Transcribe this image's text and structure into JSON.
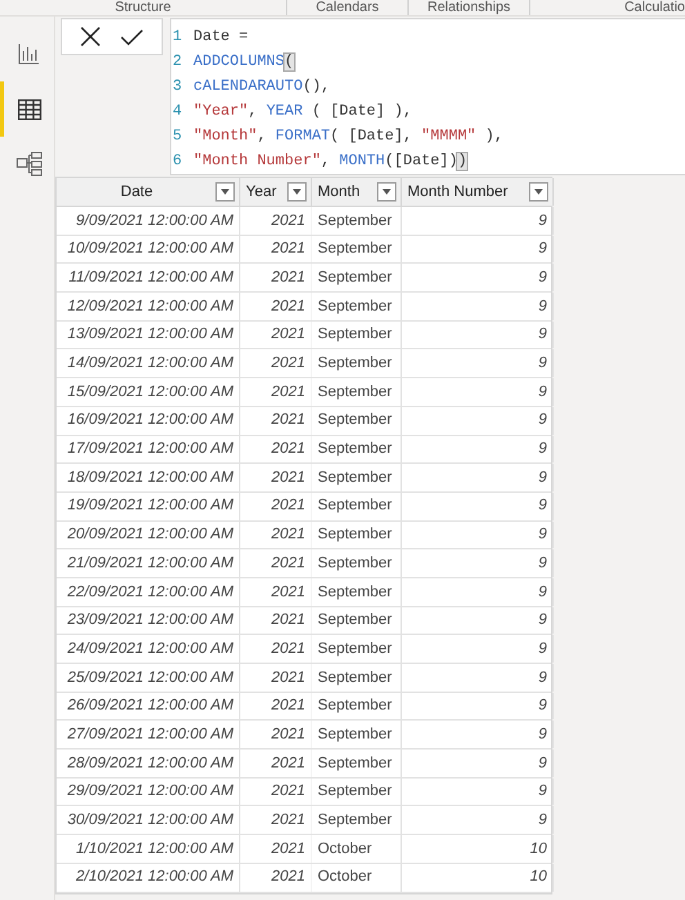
{
  "ribbon": {
    "groups": [
      "Structure",
      "Calendars",
      "Relationships",
      "Calculatio"
    ]
  },
  "sidebar": {
    "items": [
      {
        "kind": "report",
        "selected": false
      },
      {
        "kind": "data",
        "selected": true
      },
      {
        "kind": "model",
        "selected": false
      }
    ]
  },
  "formula_bar": {
    "lines": [
      [
        {
          "text": "Date =",
          "kind": "plain"
        }
      ],
      [
        {
          "text": "ADDCOLUMNS",
          "kind": "func"
        },
        {
          "text": "(",
          "kind": "match"
        }
      ],
      [
        {
          "text": "cALENDARAUTO",
          "kind": "func"
        },
        {
          "text": "(),",
          "kind": "plain"
        }
      ],
      [
        {
          "text": "\"Year\"",
          "kind": "string"
        },
        {
          "text": ", ",
          "kind": "plain"
        },
        {
          "text": "YEAR",
          "kind": "func"
        },
        {
          "text": " ( [Date] ),",
          "kind": "plain"
        }
      ],
      [
        {
          "text": "\"Month\"",
          "kind": "string"
        },
        {
          "text": ", ",
          "kind": "plain"
        },
        {
          "text": "FORMAT",
          "kind": "func"
        },
        {
          "text": "( [Date], ",
          "kind": "plain"
        },
        {
          "text": "\"MMMM\"",
          "kind": "string"
        },
        {
          "text": " ),",
          "kind": "plain"
        }
      ],
      [
        {
          "text": "\"Month Number\"",
          "kind": "string"
        },
        {
          "text": ", ",
          "kind": "plain"
        },
        {
          "text": "MONTH",
          "kind": "func"
        },
        {
          "text": "([Date])",
          "kind": "plain"
        },
        {
          "text": ")",
          "kind": "match"
        }
      ]
    ],
    "line_numbers": [
      "1",
      "2",
      "3",
      "4",
      "5",
      "6"
    ]
  },
  "table": {
    "columns": [
      "Date",
      "Year",
      "Month",
      "Month Number"
    ],
    "rows": [
      [
        "9/09/2021 12:00:00 AM",
        "2021",
        "September",
        "9"
      ],
      [
        "10/09/2021 12:00:00 AM",
        "2021",
        "September",
        "9"
      ],
      [
        "11/09/2021 12:00:00 AM",
        "2021",
        "September",
        "9"
      ],
      [
        "12/09/2021 12:00:00 AM",
        "2021",
        "September",
        "9"
      ],
      [
        "13/09/2021 12:00:00 AM",
        "2021",
        "September",
        "9"
      ],
      [
        "14/09/2021 12:00:00 AM",
        "2021",
        "September",
        "9"
      ],
      [
        "15/09/2021 12:00:00 AM",
        "2021",
        "September",
        "9"
      ],
      [
        "16/09/2021 12:00:00 AM",
        "2021",
        "September",
        "9"
      ],
      [
        "17/09/2021 12:00:00 AM",
        "2021",
        "September",
        "9"
      ],
      [
        "18/09/2021 12:00:00 AM",
        "2021",
        "September",
        "9"
      ],
      [
        "19/09/2021 12:00:00 AM",
        "2021",
        "September",
        "9"
      ],
      [
        "20/09/2021 12:00:00 AM",
        "2021",
        "September",
        "9"
      ],
      [
        "21/09/2021 12:00:00 AM",
        "2021",
        "September",
        "9"
      ],
      [
        "22/09/2021 12:00:00 AM",
        "2021",
        "September",
        "9"
      ],
      [
        "23/09/2021 12:00:00 AM",
        "2021",
        "September",
        "9"
      ],
      [
        "24/09/2021 12:00:00 AM",
        "2021",
        "September",
        "9"
      ],
      [
        "25/09/2021 12:00:00 AM",
        "2021",
        "September",
        "9"
      ],
      [
        "26/09/2021 12:00:00 AM",
        "2021",
        "September",
        "9"
      ],
      [
        "27/09/2021 12:00:00 AM",
        "2021",
        "September",
        "9"
      ],
      [
        "28/09/2021 12:00:00 AM",
        "2021",
        "September",
        "9"
      ],
      [
        "29/09/2021 12:00:00 AM",
        "2021",
        "September",
        "9"
      ],
      [
        "30/09/2021 12:00:00 AM",
        "2021",
        "September",
        "9"
      ],
      [
        "1/10/2021 12:00:00 AM",
        "2021",
        "October",
        "10"
      ],
      [
        "2/10/2021 12:00:00 AM",
        "2021",
        "October",
        "10"
      ]
    ]
  }
}
